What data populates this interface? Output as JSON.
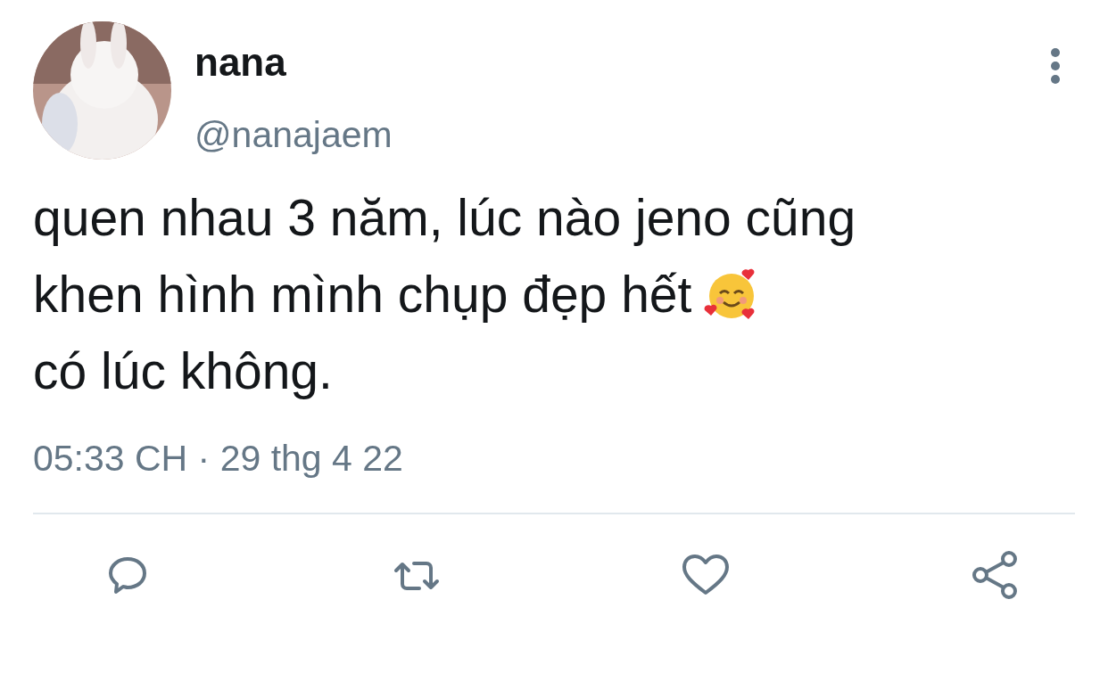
{
  "author": {
    "name": "nana",
    "handle": "@nanajaem"
  },
  "tweet": {
    "lines": [
      "quen nhau 3 năm, lúc nào jeno cũng",
      "khen hình mình chụp đẹp hết",
      "có lúc không."
    ],
    "timestamp": "05:33 CH · 29 thg 4 22"
  },
  "actions": [
    {
      "kind": "reply"
    },
    {
      "kind": "retweet"
    },
    {
      "kind": "like"
    },
    {
      "kind": "share"
    }
  ]
}
